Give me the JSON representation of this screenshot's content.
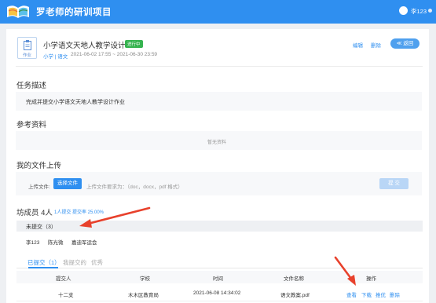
{
  "header": {
    "title": "罗老师的研训项目",
    "username": "李123"
  },
  "task": {
    "icon_label": "作业",
    "title": "小学语文天地人教学设计",
    "status": "进行中",
    "tags": "小学 | 语文",
    "dates": "2021-06-02 17:55 ~ 2021-06-30 23:59",
    "edit_label": "编辑",
    "delete_label": "删除",
    "back_label": "≪ 返回"
  },
  "description": {
    "heading": "任务描述",
    "text": "完成并提交小学语文天地人教学设计作业"
  },
  "references": {
    "heading": "参考资料",
    "empty": "暂无资料"
  },
  "upload": {
    "heading": "我的文件上传",
    "label": "上传文件:",
    "choose": "选择文件",
    "hint": "上传文件要求为：（doc，docx，pdf 格式）",
    "submit": "提 交"
  },
  "members": {
    "title": "坊成员 4人",
    "stats": "1人提交 提交率 25.00%",
    "unsubmitted_title": "未提交（3）",
    "unsubmitted_names": [
      "李123",
      "陈光微",
      "嘉迪军运会"
    ]
  },
  "tabs": [
    "已提交（1）",
    "我提交的",
    "优秀"
  ],
  "table": {
    "headers": [
      "提交人",
      "学校",
      "时间",
      "文件名称",
      "操作"
    ],
    "rows": [
      {
        "submitter": "十二支",
        "school": "木木区教育局",
        "time": "2021-06-08 14:34:02",
        "file": "语文教案.pdf",
        "actions": [
          "查看",
          "下载",
          "推优",
          "删除"
        ]
      }
    ]
  },
  "colors": {
    "brand": "#2f8ff0",
    "status": "#36b34f",
    "annotation": "#e8412c"
  },
  "icons": [
    "book-logo-icon",
    "document-icon",
    "avatar-icon",
    "chevron-down-icon",
    "arrow-annotation-icon"
  ]
}
